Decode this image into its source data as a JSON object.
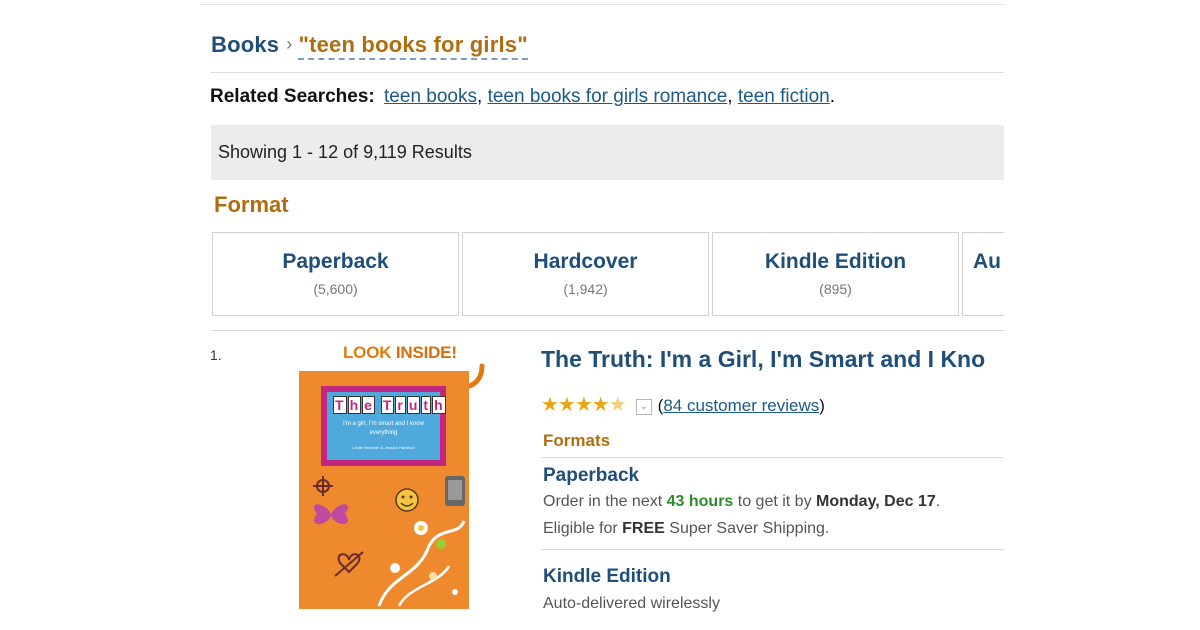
{
  "breadcrumb": {
    "root": "Books",
    "separator": "›",
    "query": "\"teen books for girls\""
  },
  "related_searches": {
    "label": "Related Searches:",
    "links": [
      "teen books",
      "teen books for girls romance",
      "teen fiction"
    ]
  },
  "results_summary": "Showing 1 - 12 of 9,119 Results",
  "format_filter": {
    "heading": "Format",
    "options": [
      {
        "name": "Paperback",
        "count": "(5,600)"
      },
      {
        "name": "Hardcover",
        "count": "(1,942)"
      },
      {
        "name": "Kindle Edition",
        "count": "(895)"
      },
      {
        "name": "Au",
        "count": ""
      }
    ]
  },
  "result": {
    "rank": "1.",
    "look_inside": {
      "prefix": "LOOK ",
      "emphasis": "INSIDE!"
    },
    "cover": {
      "title_tiles": [
        "T",
        "h",
        "e",
        " ",
        "T",
        "r",
        "u",
        "t",
        "h"
      ],
      "blurb": "I'm a girl, I'm smart and I know everything",
      "author_line": "Leslie Newman & Jessica Hamilton",
      "background_color": "#ee8a2d"
    },
    "title": "The Truth: I'm a Girl, I'm Smart and I Kno",
    "rating": {
      "stars": 4.5,
      "reviews_link": "84 customer reviews"
    },
    "formats_heading": "Formats",
    "formats": [
      {
        "name": "Paperback",
        "order_prefix": "Order in the next ",
        "order_hours": "43 hours",
        "order_mid": " to get it by ",
        "order_date": "Monday, Dec 17",
        "order_suffix": ".",
        "shipping_prefix": "Eligible for ",
        "shipping_free": "FREE",
        "shipping_suffix": " Super Saver Shipping."
      },
      {
        "name": "Kindle Edition",
        "delivery": "Auto-delivered wirelessly"
      }
    ]
  },
  "colors": {
    "link": "#1c5a87",
    "heading_blue": "#1f4e79",
    "accent_orange": "#b06d10",
    "green": "#2e8b2e",
    "star": "#e6a817"
  }
}
